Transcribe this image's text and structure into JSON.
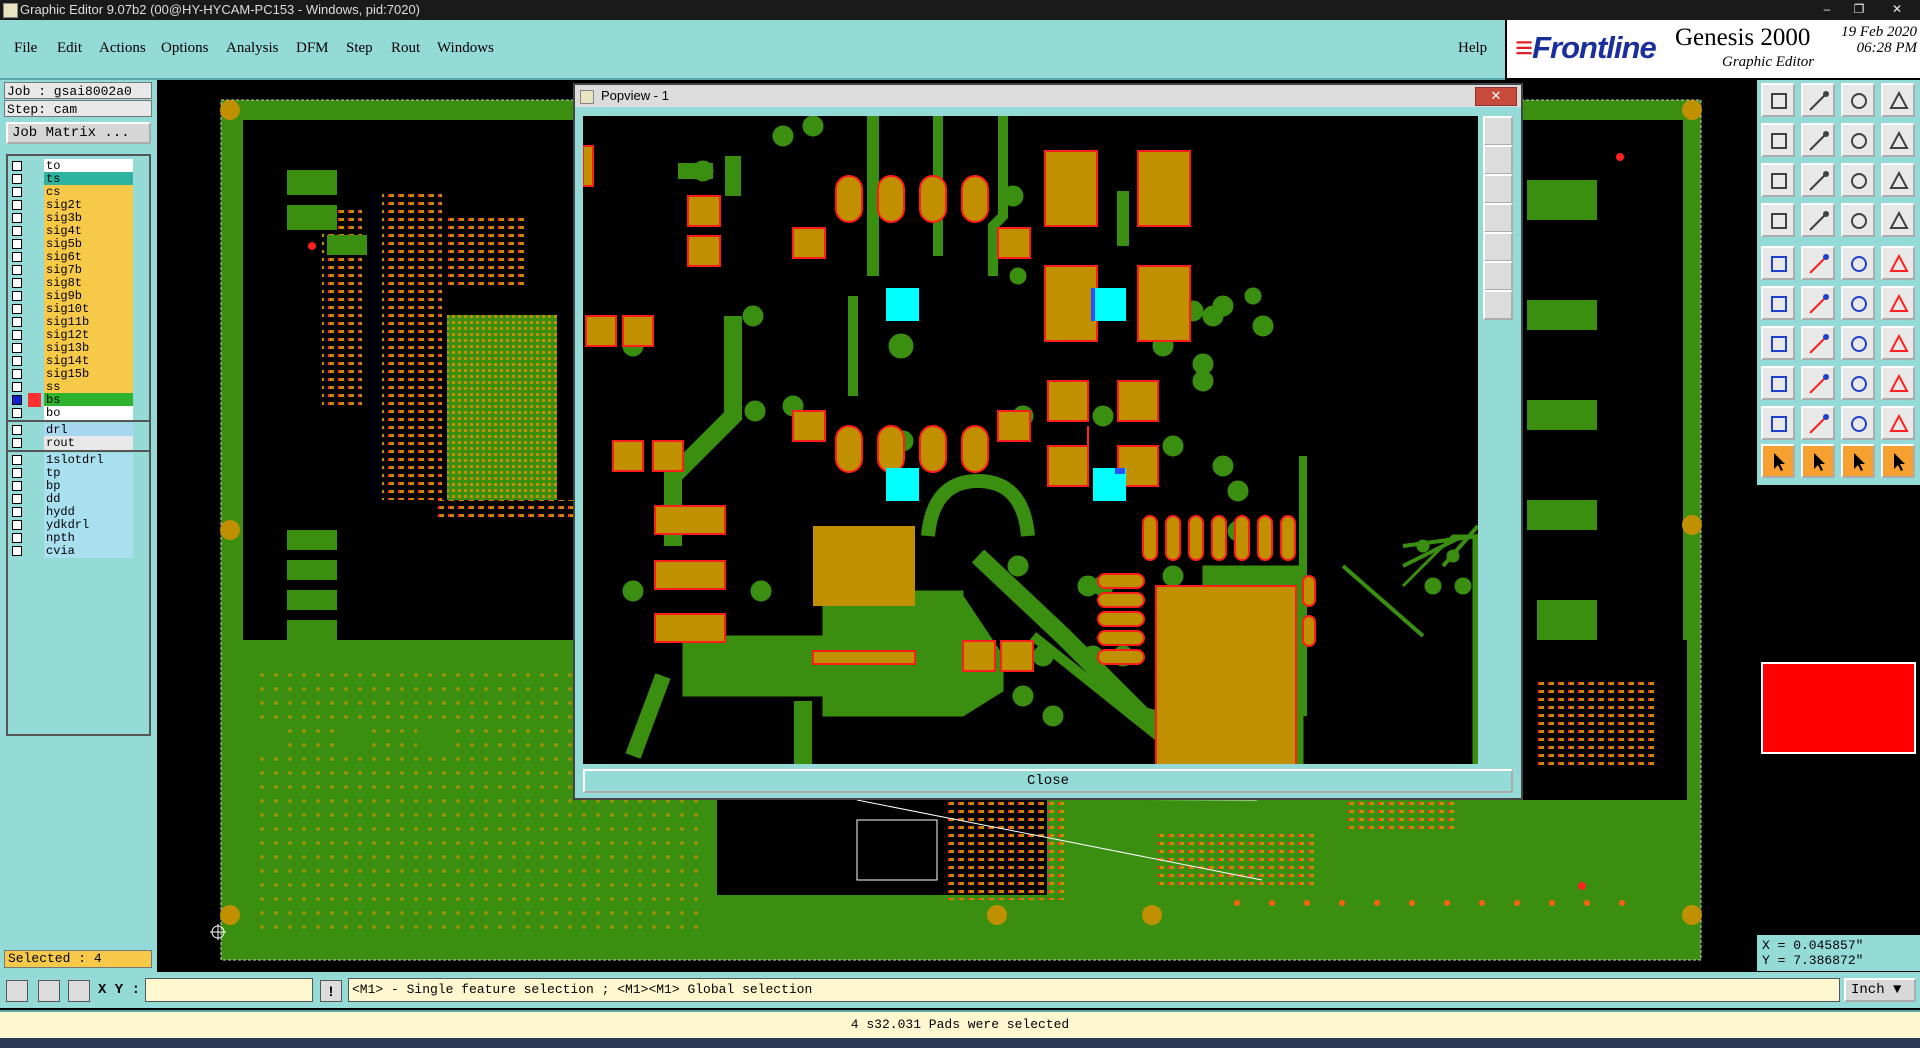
{
  "window": {
    "title": "Graphic Editor 9.07b2 (00@HY-HYCAM-PC153 - Windows, pid:7020)"
  },
  "menu": [
    "File",
    "Edit",
    "Actions",
    "Options",
    "Analysis",
    "DFM",
    "Step",
    "Rout",
    "Windows"
  ],
  "help": "Help",
  "brand": {
    "logo": "Frontline",
    "product": "Genesis 2000",
    "subtitle": "Graphic Editor",
    "date": "19 Feb 2020",
    "time": "06:28 PM"
  },
  "job": {
    "job_line": "Job : gsai8002a0",
    "step_line": "Step: cam",
    "matrix_button": "Job Matrix ..."
  },
  "layers": {
    "board": [
      {
        "name": "to",
        "color": "#ffffff",
        "mark": true
      },
      {
        "name": "ts",
        "color": "#2db3a0"
      },
      {
        "name": "cs",
        "color": "#f7c948"
      },
      {
        "name": "sig2t",
        "color": "#f7c948"
      },
      {
        "name": "sig3b",
        "color": "#f7c948"
      },
      {
        "name": "sig4t",
        "color": "#f7c948"
      },
      {
        "name": "sig5b",
        "color": "#f7c948"
      },
      {
        "name": "sig6t",
        "color": "#f7c948"
      },
      {
        "name": "sig7b",
        "color": "#f7c948"
      },
      {
        "name": "sig8t",
        "color": "#f7c948"
      },
      {
        "name": "sig9b",
        "color": "#f7c948"
      },
      {
        "name": "sig10t",
        "color": "#f7c948"
      },
      {
        "name": "sig11b",
        "color": "#f7c948"
      },
      {
        "name": "sig12t",
        "color": "#f7c948"
      },
      {
        "name": "sig13b",
        "color": "#f7c948"
      },
      {
        "name": "sig14t",
        "color": "#f7c948"
      },
      {
        "name": "sig15b",
        "color": "#f7c948"
      },
      {
        "name": "ss",
        "color": "#f7c948"
      },
      {
        "name": "bs",
        "color": "#2db32d",
        "active": true
      },
      {
        "name": "bo",
        "color": "#ffffff",
        "mark": true
      }
    ],
    "drill": [
      {
        "name": "drl",
        "color": "#a8d8f0"
      },
      {
        "name": "rout",
        "color": "#e8e8e8"
      }
    ],
    "misc": [
      {
        "name": "1slotdrl",
        "color": "#a8e0f0"
      },
      {
        "name": "tp",
        "color": "#a8e0f0"
      },
      {
        "name": "bp",
        "color": "#a8e0f0"
      },
      {
        "name": "dd",
        "color": "#a8e0f0"
      },
      {
        "name": "hydd",
        "color": "#a8e0f0"
      },
      {
        "name": "ydkdrl",
        "color": "#a8e0f0"
      },
      {
        "name": "npth",
        "color": "#a8e0f0"
      },
      {
        "name": "cvia",
        "color": "#a8e0f0"
      }
    ]
  },
  "selected_label": "Selected : 4",
  "popview": {
    "title": "Popview - 1",
    "close_label": "Close"
  },
  "coords": {
    "x": "X = 0.045857\"",
    "y": "Y = 7.386872\""
  },
  "bottom": {
    "xy_label": "X Y :",
    "xy_value": "",
    "hint": "<M1> - Single feature selection ; <M1><M1> Global selection",
    "unit": "Inch"
  },
  "status": "4 s32.031 Pads were selected",
  "colors": {
    "panel": "#94dbd8",
    "board_green": "#3b8f10",
    "pad_gold": "#c09000",
    "pad_outline": "#ff2020",
    "highlight": "#00ffff"
  }
}
